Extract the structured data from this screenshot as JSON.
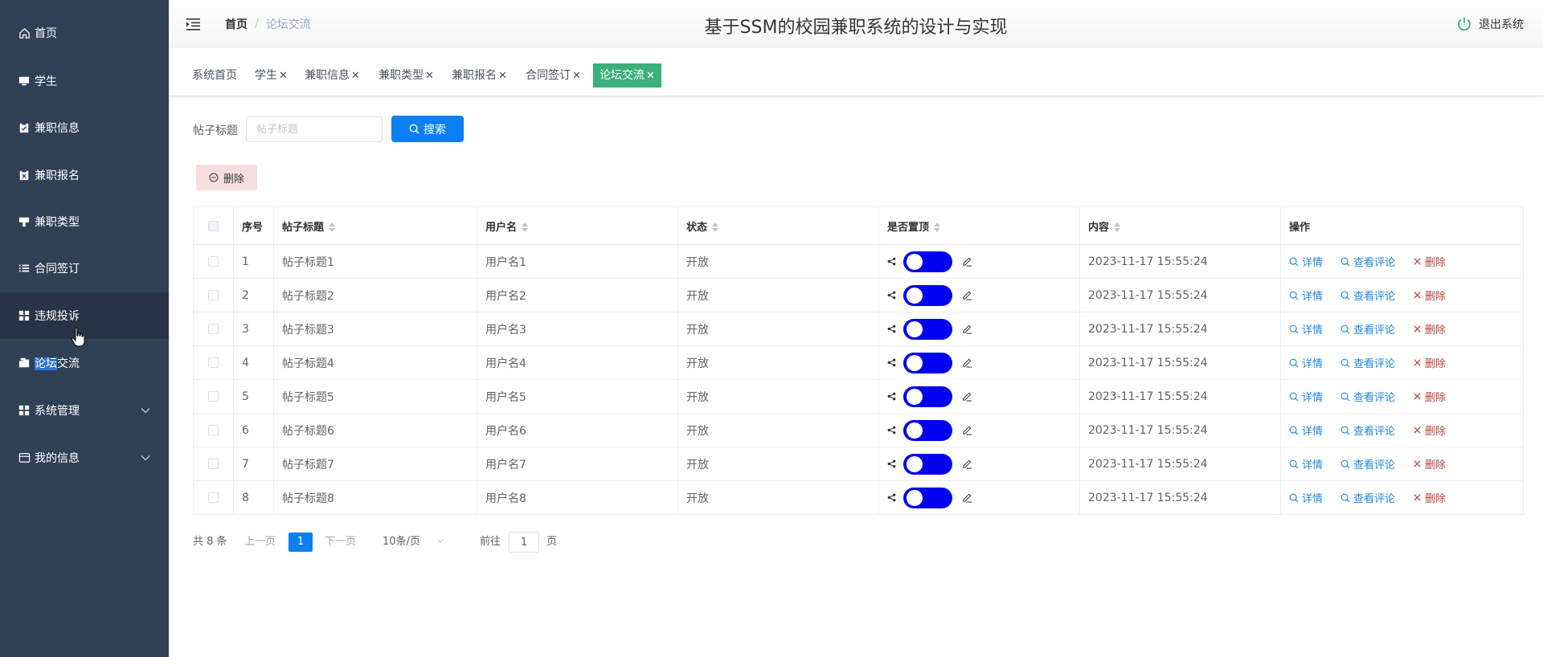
{
  "sidebar": {
    "items": [
      {
        "label": "首页",
        "icon": "home-icon"
      },
      {
        "label": "学生",
        "icon": "monitor-icon"
      },
      {
        "label": "兼职信息",
        "icon": "clipboard-check-icon"
      },
      {
        "label": "兼职报名",
        "icon": "clipboard-x-icon"
      },
      {
        "label": "兼职类型",
        "icon": "sign-icon"
      },
      {
        "label": "合同签订",
        "icon": "list-icon"
      },
      {
        "label": "违规投诉",
        "icon": "grid-icon"
      },
      {
        "label_sel": "论坛",
        "label_rest": "交流",
        "icon": "folder-icon"
      },
      {
        "label": "系统管理",
        "icon": "grid-icon"
      },
      {
        "label": "我的信息",
        "icon": "card-icon"
      }
    ]
  },
  "header": {
    "crumb_home": "首页",
    "crumb_sep": "/",
    "crumb_current": "论坛交流",
    "title": "基于SSM的校园兼职系统的设计与实现",
    "logout": "退出系统"
  },
  "tags": [
    {
      "label": "系统首页",
      "close": ""
    },
    {
      "label": "学生",
      "close": "✕"
    },
    {
      "label": "兼职信息",
      "close": "✕"
    },
    {
      "label": "兼职类型",
      "close": "✕"
    },
    {
      "label": "兼职报名",
      "close": "✕"
    },
    {
      "label": "合同签订",
      "close": "✕"
    },
    {
      "label": "论坛交流",
      "close": "✕"
    }
  ],
  "search": {
    "label": "帖子标题",
    "placeholder": "帖子标题",
    "button": "搜索"
  },
  "toolbar": {
    "delete": "删除"
  },
  "table": {
    "headers": {
      "index": "序号",
      "title": "帖子标题",
      "username": "用户名",
      "status": "状态",
      "pinned": "是否置顶",
      "content": "内容",
      "actions": "操作"
    },
    "rows": [
      {
        "index": "1",
        "title": "帖子标题1",
        "username": "用户名1",
        "status": "开放",
        "content": "2023-11-17 15:55:24"
      },
      {
        "index": "2",
        "title": "帖子标题2",
        "username": "用户名2",
        "status": "开放",
        "content": "2023-11-17 15:55:24"
      },
      {
        "index": "3",
        "title": "帖子标题3",
        "username": "用户名3",
        "status": "开放",
        "content": "2023-11-17 15:55:24"
      },
      {
        "index": "4",
        "title": "帖子标题4",
        "username": "用户名4",
        "status": "开放",
        "content": "2023-11-17 15:55:24"
      },
      {
        "index": "5",
        "title": "帖子标题5",
        "username": "用户名5",
        "status": "开放",
        "content": "2023-11-17 15:55:24"
      },
      {
        "index": "6",
        "title": "帖子标题6",
        "username": "用户名6",
        "status": "开放",
        "content": "2023-11-17 15:55:24"
      },
      {
        "index": "7",
        "title": "帖子标题7",
        "username": "用户名7",
        "status": "开放",
        "content": "2023-11-17 15:55:24"
      },
      {
        "index": "8",
        "title": "帖子标题8",
        "username": "用户名8",
        "status": "开放",
        "content": "2023-11-17 15:55:24"
      }
    ],
    "actions": {
      "detail": "详情",
      "comments": "查看评论",
      "delete": "删除"
    }
  },
  "pagination": {
    "total": "共 8 条",
    "prev": "上一页",
    "current": "1",
    "next": "下一页",
    "page_size": "10条/页",
    "goto_prefix": "前往",
    "goto_value": "1",
    "goto_suffix": "页"
  },
  "colors": {
    "sidebar_bg": "#304156",
    "sidebar_hover": "#263445",
    "primary": "#0b7ff3",
    "tag_active": "#3cb07b",
    "toggle_on": "#0000ee",
    "danger": "#b7413b",
    "delete_btn_bg": "#f7dfdf"
  }
}
